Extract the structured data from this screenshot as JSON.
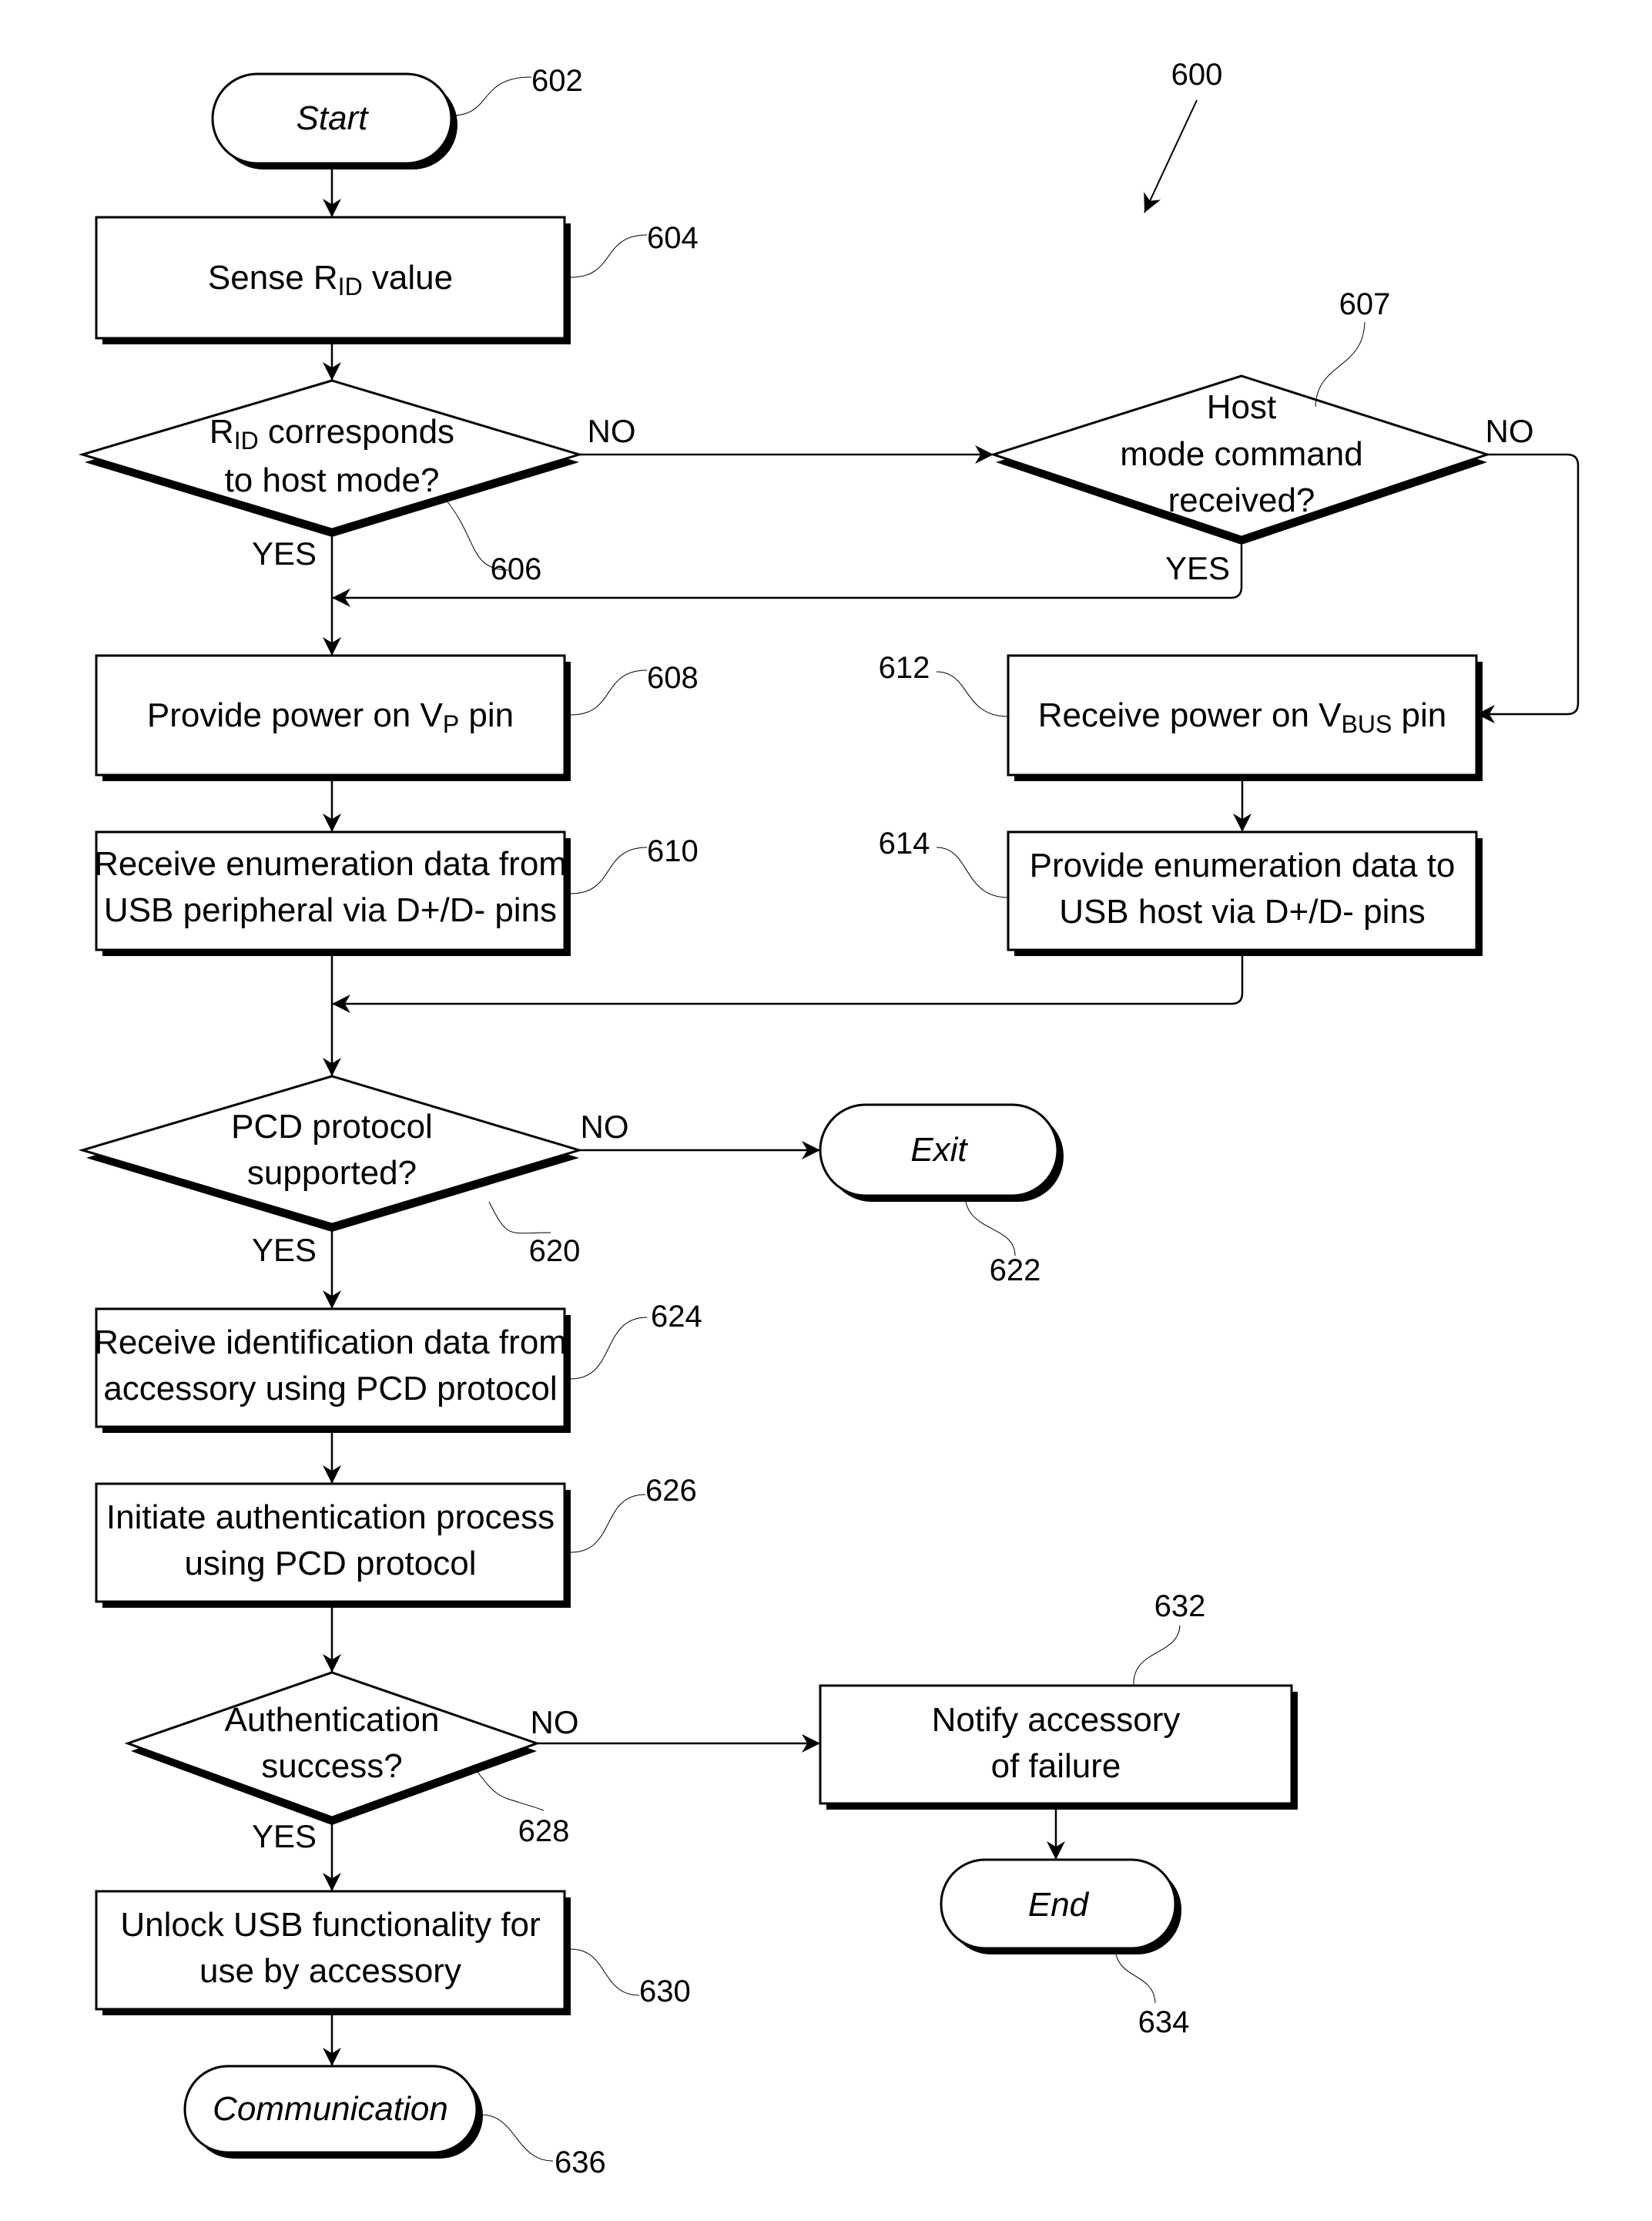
{
  "figure_ref": "600",
  "colors": {
    "stroke": "#000000",
    "fill": "#ffffff",
    "text": "#000000"
  },
  "nodes": {
    "n602": {
      "ref": "602",
      "type": "terminal",
      "lines": [
        "Start"
      ]
    },
    "n604": {
      "ref": "604",
      "type": "process",
      "main": "Sense R",
      "sub": "ID",
      "tail": " value"
    },
    "n606": {
      "ref": "606",
      "type": "decision",
      "line1_main": "R",
      "line1_sub": "ID",
      "line1_tail": " corresponds",
      "line2": "to host mode?"
    },
    "n607": {
      "ref": "607",
      "type": "decision",
      "lines": [
        "Host",
        "mode command",
        "received?"
      ]
    },
    "n608": {
      "ref": "608",
      "type": "process",
      "main": "Provide power on V",
      "sub": "P",
      "tail": " pin"
    },
    "n610": {
      "ref": "610",
      "type": "process",
      "lines": [
        "Receive enumeration data from",
        "USB peripheral via D+/D- pins"
      ]
    },
    "n612": {
      "ref": "612",
      "type": "process",
      "main": "Receive power on V",
      "sub": "BUS",
      "tail": " pin"
    },
    "n614": {
      "ref": "614",
      "type": "process",
      "lines": [
        "Provide enumeration data to",
        "USB host via D+/D- pins"
      ]
    },
    "n620": {
      "ref": "620",
      "type": "decision",
      "lines": [
        "PCD protocol",
        "supported?"
      ]
    },
    "n622": {
      "ref": "622",
      "type": "terminal",
      "lines": [
        "Exit"
      ]
    },
    "n624": {
      "ref": "624",
      "type": "process",
      "lines": [
        "Receive identification data from",
        "accessory using PCD protocol"
      ]
    },
    "n626": {
      "ref": "626",
      "type": "process",
      "lines": [
        "Initiate authentication process",
        "using PCD protocol"
      ]
    },
    "n628": {
      "ref": "628",
      "type": "decision",
      "lines": [
        "Authentication",
        "success?"
      ]
    },
    "n630": {
      "ref": "630",
      "type": "process",
      "lines": [
        "Unlock USB functionality for",
        "use by accessory"
      ]
    },
    "n632": {
      "ref": "632",
      "type": "process",
      "lines": [
        "Notify accessory",
        "of failure"
      ]
    },
    "n634": {
      "ref": "634",
      "type": "terminal",
      "lines": [
        "End"
      ]
    },
    "n636": {
      "ref": "636",
      "type": "terminal",
      "lines": [
        "Communication"
      ]
    }
  },
  "branch_labels": {
    "yes": "YES",
    "no": "NO"
  },
  "edges": [
    {
      "from": "602",
      "to": "604"
    },
    {
      "from": "604",
      "to": "606"
    },
    {
      "from": "606",
      "to": "607",
      "label": "NO"
    },
    {
      "from": "606",
      "to": "608",
      "label": "YES"
    },
    {
      "from": "607",
      "to": "608",
      "label": "YES"
    },
    {
      "from": "607",
      "to": "612",
      "label": "NO"
    },
    {
      "from": "608",
      "to": "610"
    },
    {
      "from": "612",
      "to": "614"
    },
    {
      "from": "610",
      "to": "620"
    },
    {
      "from": "614",
      "to": "620"
    },
    {
      "from": "620",
      "to": "622",
      "label": "NO"
    },
    {
      "from": "620",
      "to": "624",
      "label": "YES"
    },
    {
      "from": "624",
      "to": "626"
    },
    {
      "from": "626",
      "to": "628"
    },
    {
      "from": "628",
      "to": "632",
      "label": "NO"
    },
    {
      "from": "628",
      "to": "630",
      "label": "YES"
    },
    {
      "from": "632",
      "to": "634"
    },
    {
      "from": "630",
      "to": "636"
    }
  ]
}
